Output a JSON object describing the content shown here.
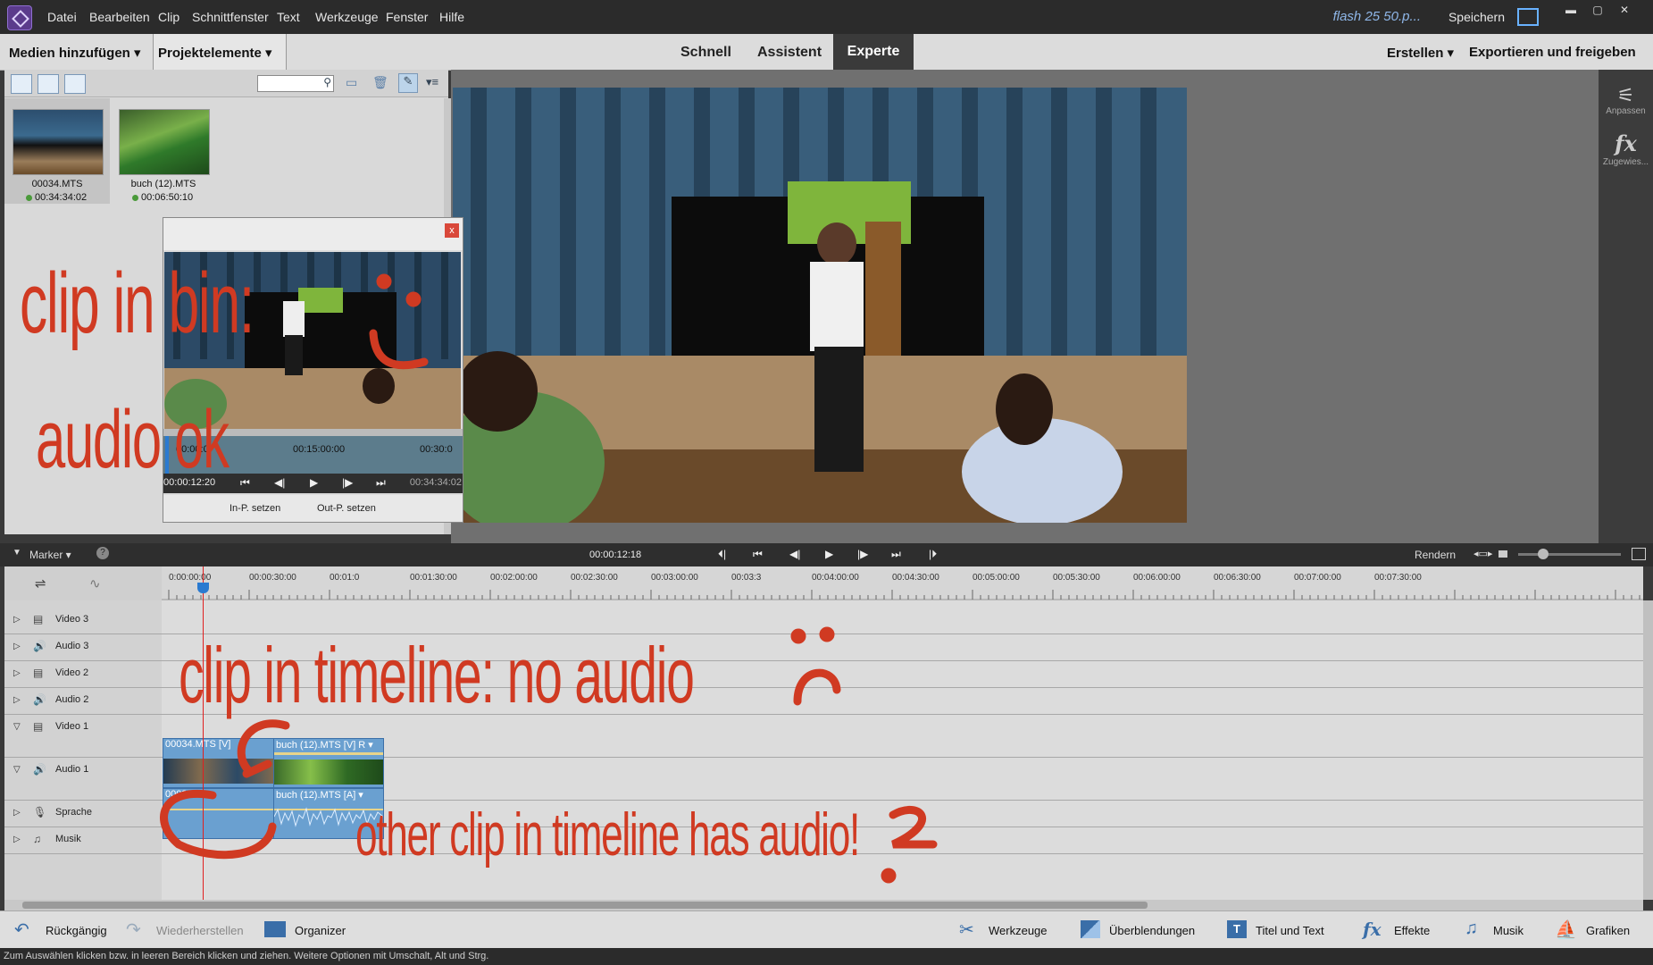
{
  "menu": {
    "items": [
      "Datei",
      "Bearbeiten",
      "Clip",
      "Schnittfenster",
      "Text",
      "Werkzeuge",
      "Fenster",
      "Hilfe"
    ],
    "project_name": "flash 25 50.p...",
    "save": "Speichern"
  },
  "toolbar": {
    "add_media": "Medien hinzufügen ▾",
    "project_assets": "Projektelemente ▾",
    "modes": [
      "Schnell",
      "Assistent",
      "Experte"
    ],
    "create": "Erstellen ▾",
    "export": "Exportieren und freigeben"
  },
  "bin": {
    "clips": [
      {
        "name": "00034.MTS",
        "duration": "00:34:34:02"
      },
      {
        "name": "buch (12).MTS",
        "duration": "00:06:50:10"
      }
    ]
  },
  "preview": {
    "close": "x",
    "tc_start": "00:00:0",
    "tc_mid": "00:15:00:00",
    "tc_right": "00:30:0",
    "current_time": "00:00:12:20",
    "end_time": "00:34:34:02",
    "set_in": "In-P. setzen",
    "set_out": "Out-P. setzen"
  },
  "sidebar": {
    "adjust": "Anpassen",
    "applied": "Zugewies..."
  },
  "transport": {
    "marker": "Marker ▾",
    "timecode": "00:00:12:18",
    "render": "Rendern"
  },
  "timeline": {
    "ruler_labels": [
      "0:00:00:00",
      "00:00:30:00",
      "00:01:0",
      "00:01:30:00",
      "00:02:00:00",
      "00:02:30:00",
      "00:03:00:00",
      "00:03:3",
      "00:04:00:00",
      "00:04:30:00",
      "00:05:00:00",
      "00:05:30:00",
      "00:06:00:00",
      "00:06:30:00",
      "00:07:00:00",
      "00:07:30:00"
    ],
    "tracks": [
      "Video 3",
      "Audio 3",
      "Video 2",
      "Audio 2",
      "Video 1",
      "Audio 1",
      "Sprache",
      "Musik"
    ],
    "clips": {
      "v1_a": "00034.MTS [V]",
      "v1_b": "buch (12).MTS [V] R ▾",
      "a1_a": "0003",
      "a1_b": "buch (12).MTS [A] ▾"
    }
  },
  "bottom": {
    "undo": "Rückgängig",
    "redo": "Wiederherstellen",
    "organizer": "Organizer",
    "tools": "Werkzeuge",
    "transitions": "Überblendungen",
    "titles": "Titel und Text",
    "effects": "Effekte",
    "music": "Musik",
    "graphics": "Grafiken"
  },
  "status": "Zum Auswählen klicken bzw. in leeren Bereich klicken und ziehen. Weitere Optionen mit Umschalt, Alt und Strg.",
  "annotations": {
    "bin_line1": "clip in bin:",
    "bin_line2": "audio ok",
    "timeline_note": "clip in timeline: no audio",
    "other_note": "other clip in timeline has audio!"
  },
  "colors": {
    "accent": "#3a6ea8",
    "annotation": "#d03a22",
    "playhead": "#e02020"
  }
}
